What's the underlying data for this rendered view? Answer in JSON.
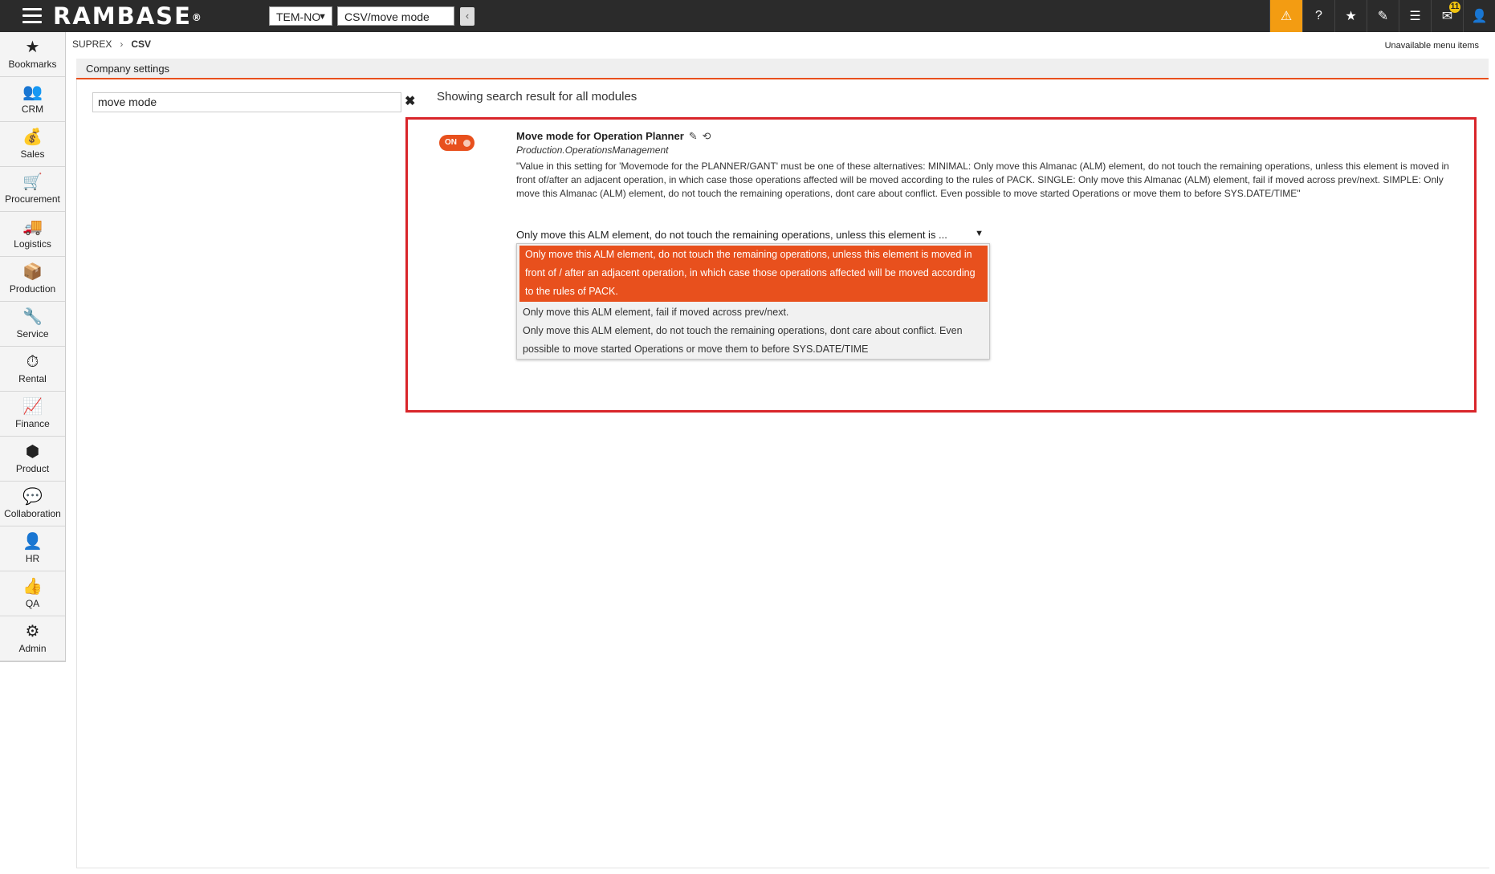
{
  "topbar": {
    "logo": "RAMBASE",
    "logo_mark": "®",
    "company": "TEM-NO",
    "search_value": "CSV/move mode",
    "back_label": "‹",
    "notification_count": "11"
  },
  "sidebar": {
    "items": [
      {
        "label": "Bookmarks",
        "icon": "★"
      },
      {
        "label": "CRM",
        "icon": "👥"
      },
      {
        "label": "Sales",
        "icon": "💰"
      },
      {
        "label": "Procurement",
        "icon": "🛒"
      },
      {
        "label": "Logistics",
        "icon": "🚚"
      },
      {
        "label": "Production",
        "icon": "📦"
      },
      {
        "label": "Service",
        "icon": "🔧"
      },
      {
        "label": "Rental",
        "icon": "⏱"
      },
      {
        "label": "Finance",
        "icon": "📈"
      },
      {
        "label": "Product",
        "icon": "⬢"
      },
      {
        "label": "Collaboration",
        "icon": "💬"
      },
      {
        "label": "HR",
        "icon": "👤"
      },
      {
        "label": "QA",
        "icon": "👍"
      },
      {
        "label": "Admin",
        "icon": "⚙"
      }
    ]
  },
  "breadcrumb": {
    "parent": "SUPREX",
    "separator": "›",
    "current": "CSV"
  },
  "unavailable_menu": "Unavailable menu items",
  "panel": {
    "title": "Company settings"
  },
  "search": {
    "value": "move mode",
    "clear": "✖",
    "result_text": "Showing search result for all modules"
  },
  "setting": {
    "toggle_label": "ON",
    "title": "Move mode for Operation Planner",
    "edit_icon": "✎",
    "reset_icon": "⟲",
    "module": "Production.OperationsManagement",
    "description": "\"Value in this setting for 'Movemode for the PLANNER/GANT' must be one of these alternatives: MINIMAL: Only move this Almanac (ALM) element, do not touch the remaining operations, unless this element is moved in front of/after an adjacent operation, in which case those operations affected will be moved according to the rules of PACK. SINGLE: Only move this Almanac (ALM) element, fail if moved across prev/next. SIMPLE: Only move this Almanac (ALM) element, do not touch the remaining operations, dont care about conflict. Even possible to move started Operations or move them to before SYS.DATE/TIME\"",
    "selected_value": "Only move this ALM element, do not touch the remaining operations, unless this element is ...",
    "options": [
      "Only move this ALM element, do not touch the remaining operations, unless this element is moved in front of / after an adjacent operation, in which case those operations affected will be moved according to the rules of PACK.",
      "Only move this ALM element, fail if moved across prev/next.",
      "Only move this ALM element, do not touch the remaining operations, dont care about conflict. Even possible to move started Operations or move them to before SYS.DATE/TIME"
    ]
  },
  "colors": {
    "accent": "#e8501d",
    "warning": "#f39c12",
    "topbar": "#2b2b2b",
    "highlight_border": "#d9252a"
  }
}
